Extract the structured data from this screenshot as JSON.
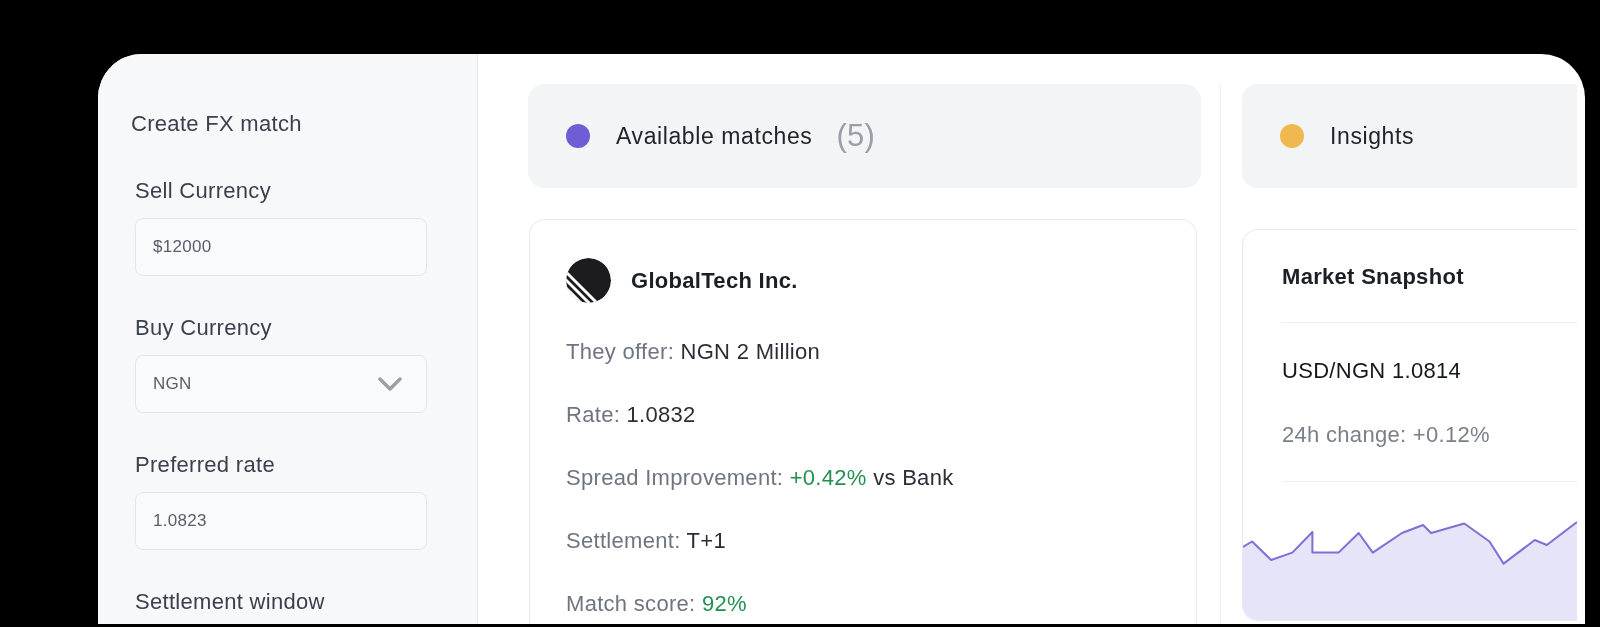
{
  "form": {
    "title": "Create FX match",
    "fields": [
      {
        "label": "Sell Currency",
        "control": {
          "kind": "text",
          "value": "$12000"
        }
      },
      {
        "label": "Buy Currency",
        "control": {
          "kind": "select",
          "value": "NGN"
        }
      },
      {
        "label": "Preferred rate",
        "control": {
          "kind": "text",
          "value": "1.0823"
        }
      },
      {
        "label": "Settlement window"
      }
    ]
  },
  "matches": {
    "title": "Available matches",
    "count": "(5)",
    "color": "#6e5ed6",
    "cards": [
      {
        "company": "GlobalTech Inc.",
        "details": [
          {
            "label": "They offer:",
            "value": "NGN 2 Million",
            "positive": false
          },
          {
            "label": "Rate:",
            "value": "1.0832",
            "positive": false
          },
          {
            "label": "Spread Improvement:",
            "value": "+0.42%",
            "positive": true,
            "note": "vs Bank"
          },
          {
            "label": "Settlement:",
            "value": "T+1",
            "positive": false
          },
          {
            "label": "Match score:",
            "value": "92%",
            "positive": true
          }
        ]
      }
    ]
  },
  "insights": {
    "title": "Insights",
    "color": "#f0b94f",
    "snapshot": {
      "title": "Market Snapshot",
      "pair": "USD/NGN 1.0814",
      "change": "24h change: +0.12%"
    }
  }
}
